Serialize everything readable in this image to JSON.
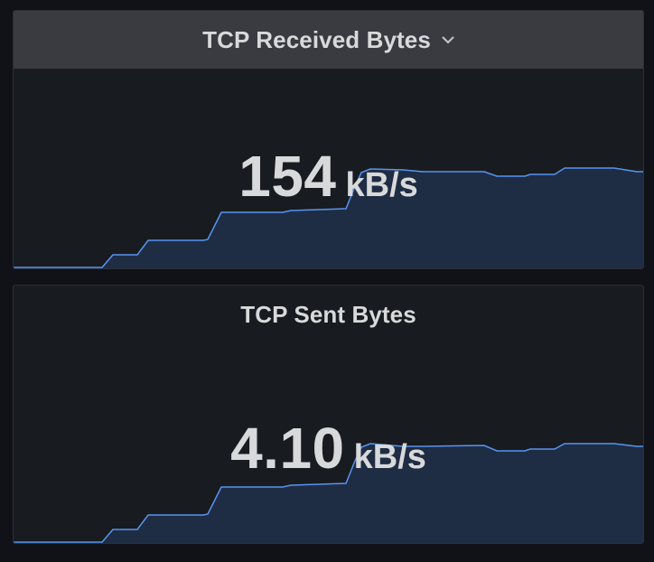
{
  "panels": [
    {
      "title": "TCP Received Bytes",
      "value": "154",
      "unit": "kB/s",
      "menu_icon": "chevron-down-icon",
      "header_highlighted": true
    },
    {
      "title": "TCP Sent Bytes",
      "value": "4.10",
      "unit": "kB/s",
      "header_highlighted": false
    }
  ],
  "colors": {
    "background": "#111217",
    "panel": "#181b1f",
    "header_hover": "#3a3b40",
    "text": "#d8d9da",
    "line": "#5794f2",
    "fill": "#1f2d44"
  }
}
